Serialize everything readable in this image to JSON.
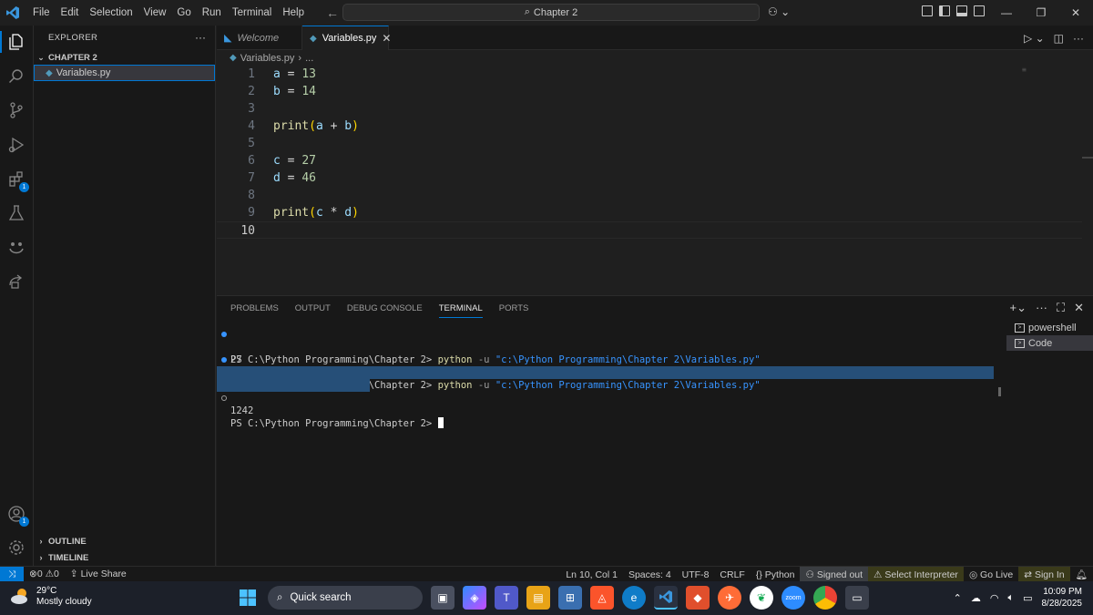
{
  "titlebar": {
    "menu": [
      "File",
      "Edit",
      "Selection",
      "View",
      "Go",
      "Run",
      "Terminal",
      "Help"
    ],
    "search_text": "Chapter 2"
  },
  "sidebar": {
    "title": "EXPLORER",
    "folder": "CHAPTER 2",
    "file": "Variables.py",
    "outline": "OUTLINE",
    "timeline": "TIMELINE"
  },
  "activity_badges": {
    "extensions": "1",
    "accounts": "1"
  },
  "tabs": [
    {
      "label": "Welcome"
    },
    {
      "label": "Variables.py"
    }
  ],
  "breadcrumb": {
    "file": "Variables.py",
    "more": "..."
  },
  "editor": {
    "line_numbers": [
      "1",
      "2",
      "3",
      "4",
      "5",
      "6",
      "7",
      "8",
      "9",
      "10"
    ],
    "lines": [
      "a = 13",
      "b = 14",
      "",
      "print(a + b)",
      "",
      "c = 27",
      "d = 46",
      "",
      "print(c * d)",
      ""
    ]
  },
  "panel": {
    "tabs": [
      "PROBLEMS",
      "OUTPUT",
      "DEBUG CONSOLE",
      "TERMINAL",
      "PORTS"
    ],
    "active_tab": "TERMINAL",
    "prompt": "PS C:\\Python Programming\\Chapter 2> ",
    "command": "python",
    "flag": " -u ",
    "arg": "\"c:\\Python Programming\\Chapter 2\\Variables.py\"",
    "output1": "27",
    "output2": "27",
    "output3": "1242",
    "terminals": [
      "powershell",
      "Code"
    ]
  },
  "statusbar": {
    "problems": "0",
    "warnings": "0",
    "live_share": "Live Share",
    "position": "Ln 10, Col 1",
    "spaces": "Spaces: 4",
    "encoding": "UTF-8",
    "eol": "CRLF",
    "language": "Python",
    "signed_out": "Signed out",
    "interpreter": "Select Interpreter",
    "go_live": "Go Live",
    "sign_in": "Sign In"
  },
  "taskbar": {
    "temp": "29°C",
    "weather": "Mostly cloudy",
    "search": "Quick search",
    "time": "10:09 PM",
    "date": "8/28/2025"
  },
  "colors": {
    "accent": "#0078d4",
    "keyword_var": "#9cdcfe",
    "number": "#b5cea8",
    "function": "#dcdcaa"
  }
}
